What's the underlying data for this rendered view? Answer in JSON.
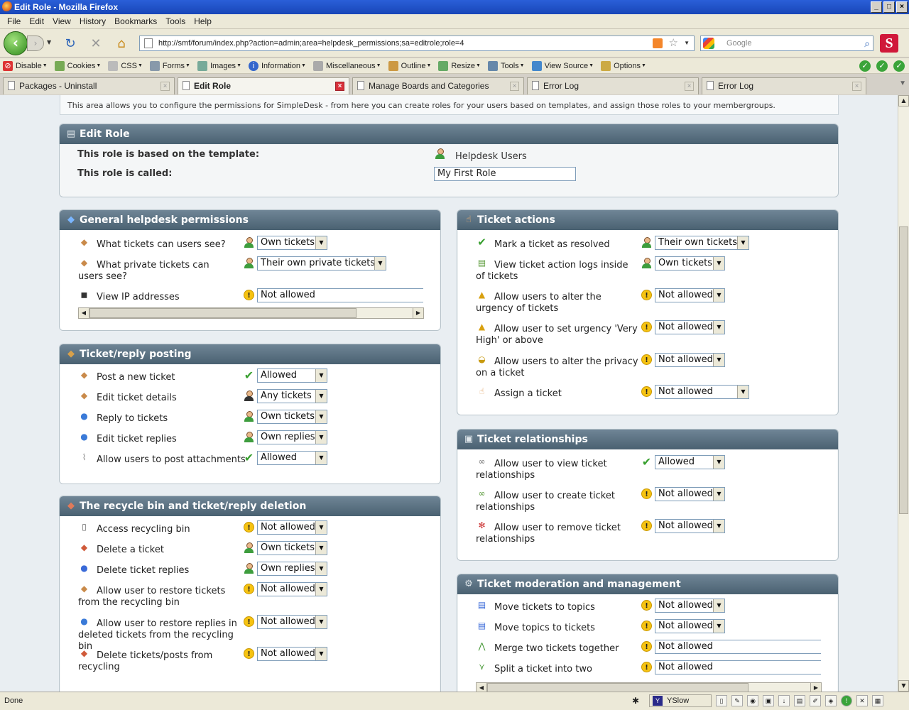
{
  "window": {
    "title": "Edit Role - Mozilla Firefox"
  },
  "menu": [
    "File",
    "Edit",
    "View",
    "History",
    "Bookmarks",
    "Tools",
    "Help"
  ],
  "url": "http://smf/forum/index.php?action=admin;area=helpdesk_permissions;sa=editrole;role=4",
  "search": {
    "placeholder": "Google"
  },
  "devbar": [
    "Disable",
    "Cookies",
    "CSS",
    "Forms",
    "Images",
    "Information",
    "Miscellaneous",
    "Outline",
    "Resize",
    "Tools",
    "View Source",
    "Options"
  ],
  "tabs": [
    {
      "label": "Packages - Uninstall",
      "active": false
    },
    {
      "label": "Edit Role",
      "active": true
    },
    {
      "label": "Manage Boards and Categories",
      "active": false
    },
    {
      "label": "Error Log",
      "active": false
    },
    {
      "label": "Error Log",
      "active": false
    }
  ],
  "description": "This area allows you to configure the permissions for SimpleDesk - from here you can create roles for your users based on templates, and assign those roles to your membergroups.",
  "edit_role": {
    "title": "Edit Role",
    "template_label": "This role is based on the template:",
    "template_value": "Helpdesk Users",
    "called_label": "This role is called:",
    "called_value": "My First Role"
  },
  "general": {
    "title": "General helpdesk permissions",
    "rows": [
      {
        "label": "What tickets can users see?",
        "value": "Own tickets"
      },
      {
        "label": "What private tickets can users see?",
        "value": "Their own private tickets"
      },
      {
        "label": "View IP addresses",
        "value": "Not allowed"
      }
    ]
  },
  "posting": {
    "title": "Ticket/reply posting",
    "rows": [
      {
        "label": "Post a new ticket",
        "value": "Allowed"
      },
      {
        "label": "Edit ticket details",
        "value": "Any tickets"
      },
      {
        "label": "Reply to tickets",
        "value": "Own tickets"
      },
      {
        "label": "Edit ticket replies",
        "value": "Own replies"
      },
      {
        "label": "Allow users to post attachments",
        "value": "Allowed"
      }
    ]
  },
  "recycle": {
    "title": "The recycle bin and ticket/reply deletion",
    "rows": [
      {
        "label": "Access recycling bin",
        "value": "Not allowed"
      },
      {
        "label": "Delete a ticket",
        "value": "Own tickets"
      },
      {
        "label": "Delete ticket replies",
        "value": "Own replies"
      },
      {
        "label": "Allow user to restore tickets from the recycling bin",
        "value": "Not allowed"
      },
      {
        "label": "Allow user to restore replies in deleted tickets from the recycling bin",
        "value": "Not allowed"
      },
      {
        "label": "Delete tickets/posts from recycling",
        "value": "Not allowed"
      }
    ]
  },
  "actions": {
    "title": "Ticket actions",
    "rows": [
      {
        "label": "Mark a ticket as resolved",
        "value": "Their own tickets"
      },
      {
        "label": "View ticket action logs inside of tickets",
        "value": "Own tickets"
      },
      {
        "label": "Allow users to alter the urgency of tickets",
        "value": "Not allowed"
      },
      {
        "label": "Allow user to set urgency 'Very High' or above",
        "value": "Not allowed"
      },
      {
        "label": "Allow users to alter the privacy on a ticket",
        "value": "Not allowed"
      },
      {
        "label": "Assign a ticket",
        "value": "Not allowed"
      }
    ]
  },
  "relationships": {
    "title": "Ticket relationships",
    "rows": [
      {
        "label": "Allow user to view ticket relationships",
        "value": "Allowed"
      },
      {
        "label": "Allow user to create ticket relationships",
        "value": "Not allowed"
      },
      {
        "label": "Allow user to remove ticket relationships",
        "value": "Not allowed"
      }
    ]
  },
  "moderation": {
    "title": "Ticket moderation and management",
    "rows": [
      {
        "label": "Move tickets to topics",
        "value": "Not allowed"
      },
      {
        "label": "Move topics to tickets",
        "value": "Not allowed"
      },
      {
        "label": "Merge two tickets together",
        "value": "Not allowed"
      },
      {
        "label": "Split a ticket into two",
        "value": "Not allowed"
      }
    ]
  },
  "status": {
    "text": "Done",
    "yslow": "YSlow"
  }
}
